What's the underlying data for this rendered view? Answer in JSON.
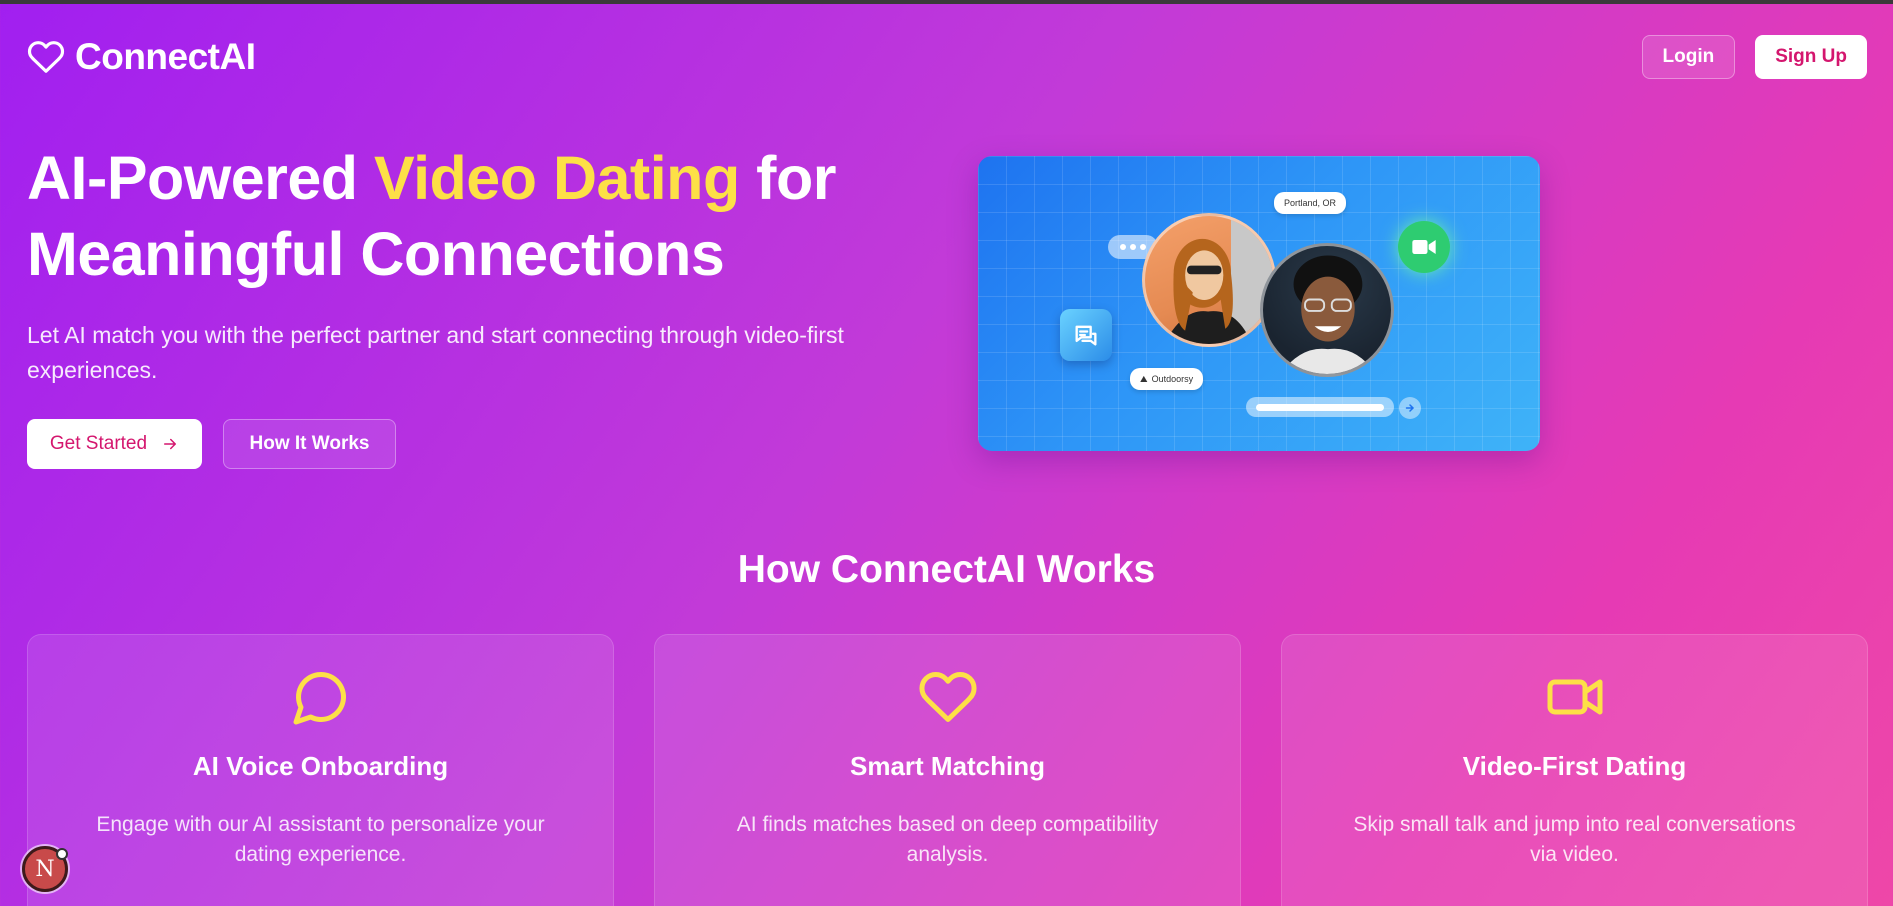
{
  "header": {
    "brand": "ConnectAI",
    "login_label": "Login",
    "signup_label": "Sign Up"
  },
  "hero": {
    "title_part1": "AI-Powered ",
    "title_highlight": "Video Dating",
    "title_part2": " for Meaningful Connections",
    "subtitle": "Let AI match you with the perfect partner and start connecting through video-first experiences.",
    "primary_cta": "Get Started",
    "secondary_cta": "How It Works"
  },
  "illustration": {
    "location_tag": "Portland, OR",
    "interest_tag": "Outdoorsy"
  },
  "how_it_works": {
    "title": "How ConnectAI Works",
    "cards": [
      {
        "icon": "chat-bubble-icon",
        "title": "AI Voice Onboarding",
        "description": "Engage with our AI assistant to personalize your dating experience."
      },
      {
        "icon": "heart-icon",
        "title": "Smart Matching",
        "description": "AI finds matches based on deep compatibility analysis."
      },
      {
        "icon": "video-camera-icon",
        "title": "Video-First Dating",
        "description": "Skip small talk and jump into real conversations via video."
      }
    ]
  },
  "dev_badge": {
    "letter": "N"
  },
  "colors": {
    "highlight": "#fde047",
    "accent_text": "#d4166e",
    "gradient_start": "#a11ff0",
    "gradient_end": "#ee47a8"
  }
}
